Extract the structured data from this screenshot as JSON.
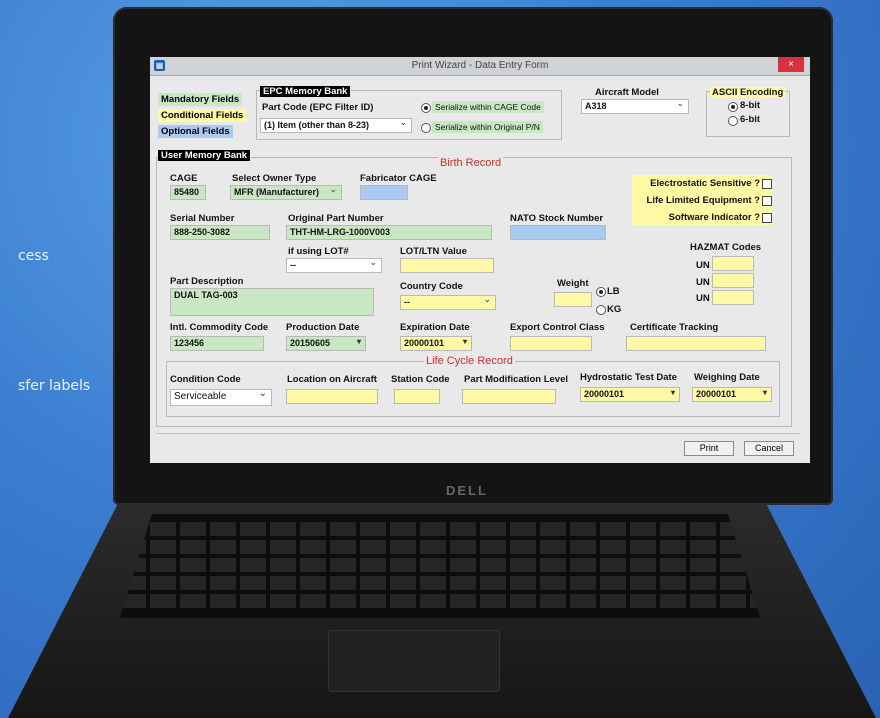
{
  "background": {
    "left_text_1": "cess",
    "left_text_2": "sfer labels"
  },
  "laptop": {
    "brand": "DELL"
  },
  "window": {
    "title": "Print Wizard - Data Entry Form",
    "close": "×"
  },
  "legend": {
    "mandatory": "Mandatory Fields",
    "conditional": "Conditional Fields",
    "optional": "Optional Fields"
  },
  "colors": {
    "mandatory": "#c9e7c3",
    "conditional": "#fff9a6",
    "optional": "#a9cbf2"
  },
  "epc": {
    "title": "EPC Memory Bank",
    "part_code_label": "Part Code (EPC Filter ID)",
    "part_code_value": "(1) Item (other than 8-23)",
    "serialize_cage": "Serialize within CAGE Code",
    "serialize_pn": "Serialize within Original P/N"
  },
  "aircraft": {
    "label": "Aircraft Model",
    "value": "A318"
  },
  "ascii": {
    "title": "ASCII Encoding",
    "opt8": "8-bit",
    "opt6": "6-bit"
  },
  "user_memory": {
    "title": "User Memory Bank"
  },
  "birth": {
    "title": "Birth Record",
    "cage_label": "CAGE",
    "cage_value": "85480",
    "owner_label": "Select Owner Type",
    "owner_value": "MFR (Manufacturer)",
    "fabricator_label": "Fabricator CAGE",
    "electrostatic": "Electrostatic Sensitive ?",
    "life_limited": "Life Limited Equipment ?",
    "software": "Software Indicator ?",
    "serial_label": "Serial Number",
    "serial_value": "888-250-3082",
    "opn_label": "Original Part Number",
    "opn_value": "THT-HM-LRG-1000V003",
    "nato_label": "NATO Stock Number",
    "lot_label": "if using LOT#",
    "lot_value": "--",
    "lotltn_label": "LOT/LTN Value",
    "hazmat_label": "HAZMAT Codes",
    "un": "UN",
    "desc_label": "Part Description",
    "desc_value": "DUAL TAG-003",
    "country_label": "Country Code",
    "country_value": "--",
    "weight_label": "Weight",
    "lb": "LB",
    "kg": "KG",
    "icc_label": "Intl. Commodity Code",
    "icc_value": "123456",
    "prod_label": "Production Date",
    "prod_value": "20150605",
    "exp_label": "Expiration Date",
    "exp_value": "20000101",
    "export_label": "Export Control Class",
    "cert_label": "Certificate Tracking"
  },
  "lifecycle": {
    "title": "Life Cycle Record",
    "condition_label": "Condition Code",
    "condition_value": "Serviceable",
    "location_label": "Location on Aircraft",
    "station_label": "Station Code",
    "mod_label": "Part Modification Level",
    "hydro_label": "Hydrostatic Test Date",
    "hydro_value": "20000101",
    "weigh_label": "Weighing Date",
    "weigh_value": "20000101"
  },
  "buttons": {
    "print": "Print",
    "cancel": "Cancel"
  }
}
